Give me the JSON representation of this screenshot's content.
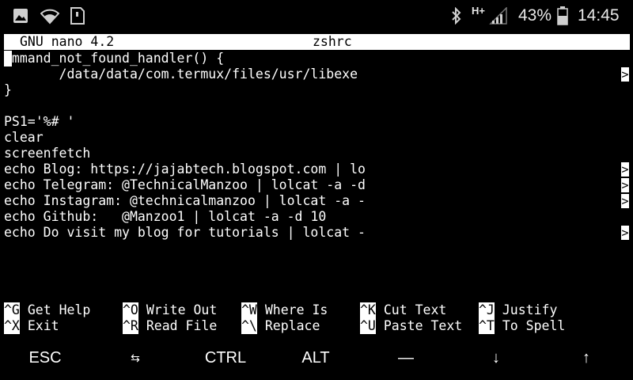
{
  "status_bar": {
    "battery_percent": "43%",
    "time": "14:45",
    "network_label": "H+",
    "left_icons": [
      "image-icon",
      "wifi-icon",
      "sim-card-icon"
    ],
    "right_icons": [
      "bluetooth-icon",
      "signal-icon",
      "battery-icon"
    ]
  },
  "editor": {
    "app_version": "GNU nano 4.2",
    "filename": "zshrc",
    "lines": [
      {
        "text": "ommand_not_found_handler() {",
        "more": false
      },
      {
        "text": "       /data/data/com.termux/files/usr/libexe",
        "more": true
      },
      {
        "text": "}",
        "more": false
      },
      {
        "text": "",
        "more": false
      },
      {
        "text": "PS1='%# '",
        "more": false
      },
      {
        "text": "clear",
        "more": false
      },
      {
        "text": "screenfetch",
        "more": false
      },
      {
        "text": "echo Blog: https://jajabtech.blogspot.com | lo",
        "more": true
      },
      {
        "text": "echo Telegram: @TechnicalManzoo | lolcat -a -d",
        "more": true
      },
      {
        "text": "echo Instagram: @technicalmanzoo | lolcat -a -",
        "more": true
      },
      {
        "text": "echo Github:   @Manzoo1 | lolcat -a -d 10",
        "more": false
      },
      {
        "text": "echo Do visit my blog for tutorials | lolcat -",
        "more": true
      }
    ],
    "more_marker": ">"
  },
  "shortcuts": {
    "row1": [
      {
        "key": "^G",
        "label": "Get Help"
      },
      {
        "key": "^O",
        "label": "Write Out"
      },
      {
        "key": "^W",
        "label": "Where Is"
      },
      {
        "key": "^K",
        "label": "Cut Text"
      },
      {
        "key": "^J",
        "label": "Justify"
      }
    ],
    "row2": [
      {
        "key": "^X",
        "label": "Exit"
      },
      {
        "key": "^R",
        "label": "Read File"
      },
      {
        "key": "^\\",
        "label": "Replace"
      },
      {
        "key": "^U",
        "label": "Paste Text"
      },
      {
        "key": "^T",
        "label": "To Spell"
      }
    ]
  },
  "extra_keys": [
    "ESC",
    "⇆",
    "CTRL",
    "ALT",
    "—",
    "↓",
    "↑"
  ]
}
